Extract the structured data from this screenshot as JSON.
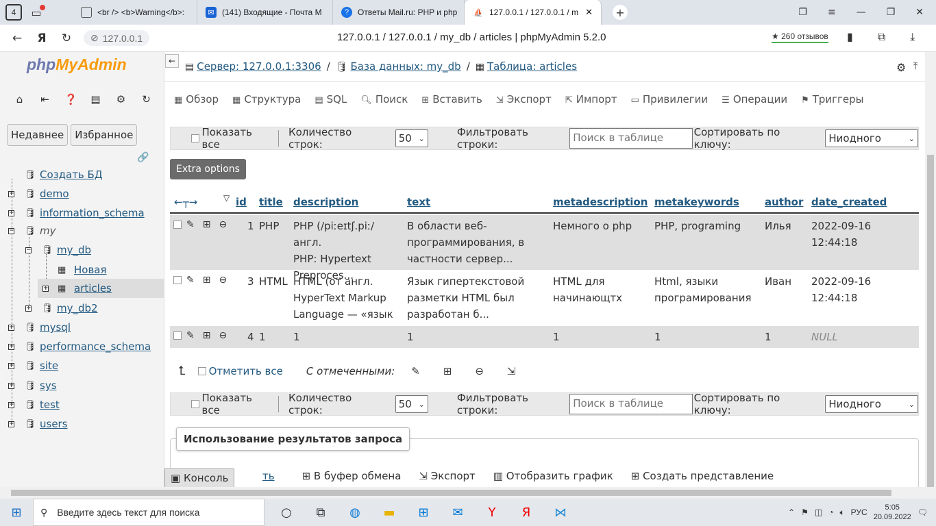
{
  "browser": {
    "tab_count": "4",
    "tabs": [
      {
        "title": "<br /> <b>Warning</b>:"
      },
      {
        "title": "(141) Входящие - Почта М"
      },
      {
        "title": "Ответы Mail.ru: PHP и php"
      },
      {
        "title": "127.0.0.1 / 127.0.0.1 / m"
      }
    ],
    "address_pill": "127.0.0.1",
    "page_title": "127.0.0.1 / 127.0.0.1 / my_db / articles | phpMyAdmin 5.2.0",
    "reviews": "★ 260 отзывов"
  },
  "sidebar": {
    "logo_php": "php",
    "logo_myadmin": "MyAdmin",
    "tab_recent": "Недавнее",
    "tab_favorites": "Избранное",
    "tree": {
      "create_db": "Создать БД",
      "demo": "demo",
      "information_schema": "information_schema",
      "my": "my",
      "my_db": "my_db",
      "new": "Новая",
      "articles": "articles",
      "my_db2": "my_db2",
      "mysql": "mysql",
      "performance_schema": "performance_schema",
      "site": "site",
      "sys": "sys",
      "test": "test",
      "users": "users"
    }
  },
  "breadcrumb": {
    "server": "Сервер: 127.0.0.1:3306",
    "database": "База данных: my_db",
    "table": "Таблица: articles"
  },
  "menu": {
    "browse": "Обзор",
    "structure": "Структура",
    "sql": "SQL",
    "search": "Поиск",
    "insert": "Вставить",
    "export": "Экспорт",
    "import": "Импорт",
    "privileges": "Привилегии",
    "operations": "Операции",
    "triggers": "Триггеры"
  },
  "navigation": {
    "show_all": "Показать все",
    "rows_label": "Количество строк:",
    "rows_value": "50",
    "filter_label": "Фильтровать строки:",
    "filter_placeholder": "Поиск в таблице",
    "sort_label": "Сортировать по ключу:",
    "sort_value": "Ниодного"
  },
  "extra_options": "Extra options",
  "table": {
    "columns": [
      "id",
      "title",
      "description",
      "text",
      "metadescription",
      "metakeywords",
      "author",
      "date_created"
    ],
    "rows": [
      {
        "id": "1",
        "title": "PHP",
        "description": [
          "PHP (/piːeɪtʃ.piː/ англ.",
          "PHP: Hypertext",
          "Preproces..."
        ],
        "text": [
          "В области веб-",
          "программирования, в",
          "частности сервер..."
        ],
        "metadescription": "Немного о php",
        "metakeywords": "PHP, programing",
        "author": "Илья",
        "date_created": "2022-09-16 12:44:18"
      },
      {
        "id": "3",
        "title": "HTML",
        "description": [
          "HTML (от англ.",
          "HyperText Markup",
          "Language — «язык г..."
        ],
        "text": [
          "Язык гипертекстовой",
          "разметки HTML был",
          "разработан б..."
        ],
        "metadescription": [
          "HTML для",
          "начинающтх"
        ],
        "metakeywords": [
          "Html, языки",
          "програмирования"
        ],
        "author": "Иван",
        "date_created": "2022-09-16 12:44:18"
      },
      {
        "id": "4",
        "title": "1",
        "description": "1",
        "text": "1",
        "metadescription": "1",
        "metakeywords": "1",
        "author": "1",
        "date_created": "NULL"
      }
    ]
  },
  "with_selected": {
    "check_all": "Отметить все",
    "label": "С отмеченными:"
  },
  "query_results": {
    "title": "Использование результатов запроса",
    "print": "ть",
    "clipboard": "В буфер обмена",
    "export": "Экспорт",
    "chart": "Отобразить график",
    "view": "Создать представление"
  },
  "console": "Консоль",
  "taskbar": {
    "search_placeholder": "Введите здесь текст для поиска",
    "lang": "РУС",
    "time": "5:05",
    "date": "20.09.2022"
  }
}
